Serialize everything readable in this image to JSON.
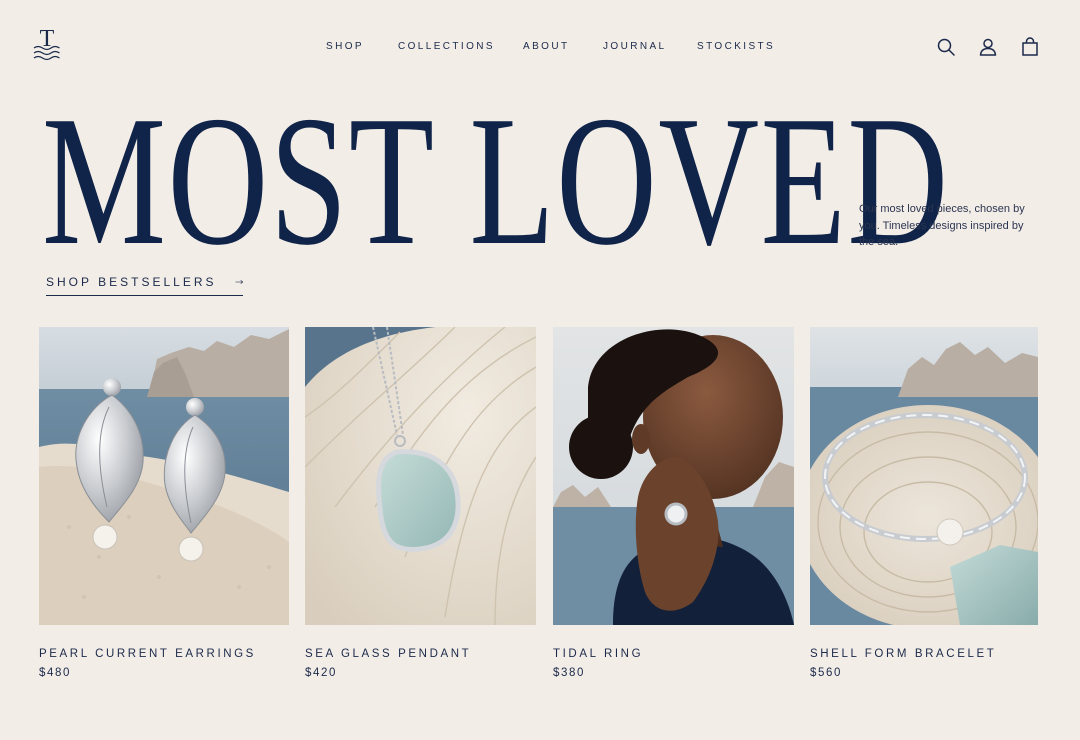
{
  "brand": {
    "logo_letter": "T"
  },
  "nav": {
    "items": [
      "SHOP",
      "COLLECTIONS",
      "ABOUT",
      "JOURNAL",
      "STOCKISTS"
    ],
    "icons": [
      "search-icon",
      "account-icon",
      "bag-icon"
    ]
  },
  "hero": {
    "title": "MOST LOVED",
    "description": "Our most loved pieces, chosen by you. Timeless designs inspired by the sea.",
    "cta": "SHOP BESTSELLERS"
  },
  "products": [
    {
      "name": "PEARL CURRENT EARRINGS",
      "price": "$480"
    },
    {
      "name": "SEA GLASS PENDANT",
      "price": "$420"
    },
    {
      "name": "TIDAL RING",
      "price": "$380"
    },
    {
      "name": "SHELL FORM BRACELET",
      "price": "$560"
    }
  ],
  "colors": {
    "background": "#f3ede8",
    "navy": "#0f2448",
    "text": "#1b2a4a",
    "sea": "#5f7f97",
    "sand": "#e7dccd"
  }
}
